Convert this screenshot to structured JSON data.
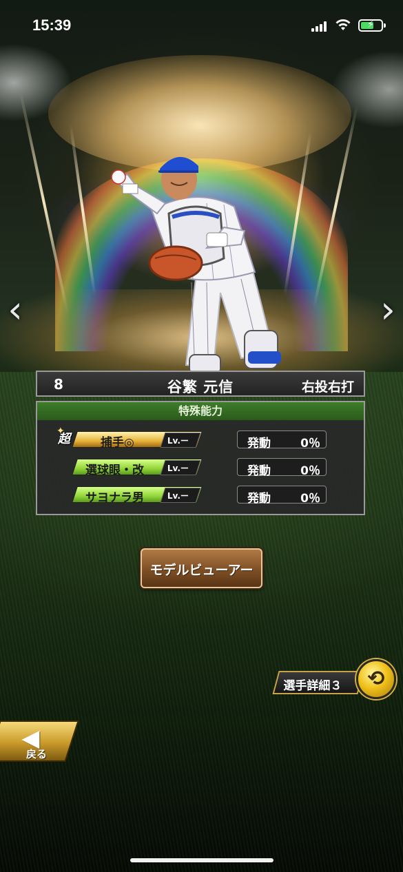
{
  "status_bar": {
    "time": "15:39",
    "icons": [
      "signal-icon",
      "wifi-icon",
      "battery-charging-icon"
    ]
  },
  "player": {
    "number": "8",
    "name": "谷繁 元信",
    "batting_throwing": "右投右打"
  },
  "abilities": {
    "header": "特殊能力",
    "super_badge": "超",
    "items": [
      {
        "name": "捕手◎",
        "level": "Lv.ー",
        "activation_label": "発動",
        "activation_value": "0％",
        "tier": "gold"
      },
      {
        "name": "選球眼・改",
        "level": "Lv.ー",
        "activation_label": "発動",
        "activation_value": "0％",
        "tier": "green"
      },
      {
        "name": "サヨナラ男",
        "level": "Lv.ー",
        "activation_label": "発動",
        "activation_value": "0％",
        "tier": "green"
      }
    ]
  },
  "buttons": {
    "model_viewer": "モデルビューアー",
    "detail": "選手詳細３",
    "back": "戻る"
  },
  "colors": {
    "ability_header": "#3e7d2a",
    "gold_tag": "#e6b43a",
    "green_tag": "#93d63a",
    "model_button": "#7e4f25",
    "swap_button": "#f1c21c"
  }
}
